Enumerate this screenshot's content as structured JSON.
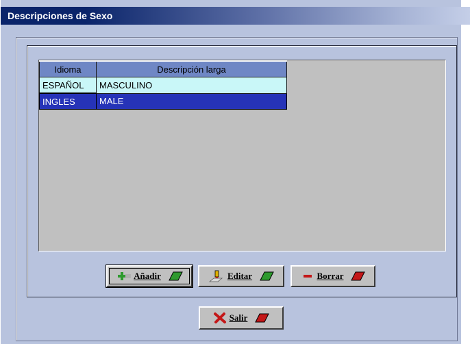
{
  "window": {
    "title": "Descripciones de Sexo"
  },
  "grid": {
    "columns": [
      "Idioma",
      "Descripción larga"
    ],
    "rows": [
      {
        "idioma": "ESPAÑOL",
        "descripcion": "MASCULINO",
        "state": "current"
      },
      {
        "idioma": "INGLES",
        "descripcion": "MALE",
        "state": "selected"
      }
    ]
  },
  "buttons": {
    "anadir": {
      "label": "Añadir",
      "icon": "plus-icon"
    },
    "editar": {
      "label": "Editar",
      "icon": "pencil-icon"
    },
    "borrar": {
      "label": "Borrar",
      "icon": "minus-icon"
    },
    "salir": {
      "label": "Salir",
      "icon": "x-icon"
    }
  },
  "colors": {
    "accent_green": "#2e9a2e",
    "accent_red": "#c41818",
    "selected_row": "#2633b8",
    "current_row": "#c9f7f8",
    "header": "#6f87c5"
  }
}
